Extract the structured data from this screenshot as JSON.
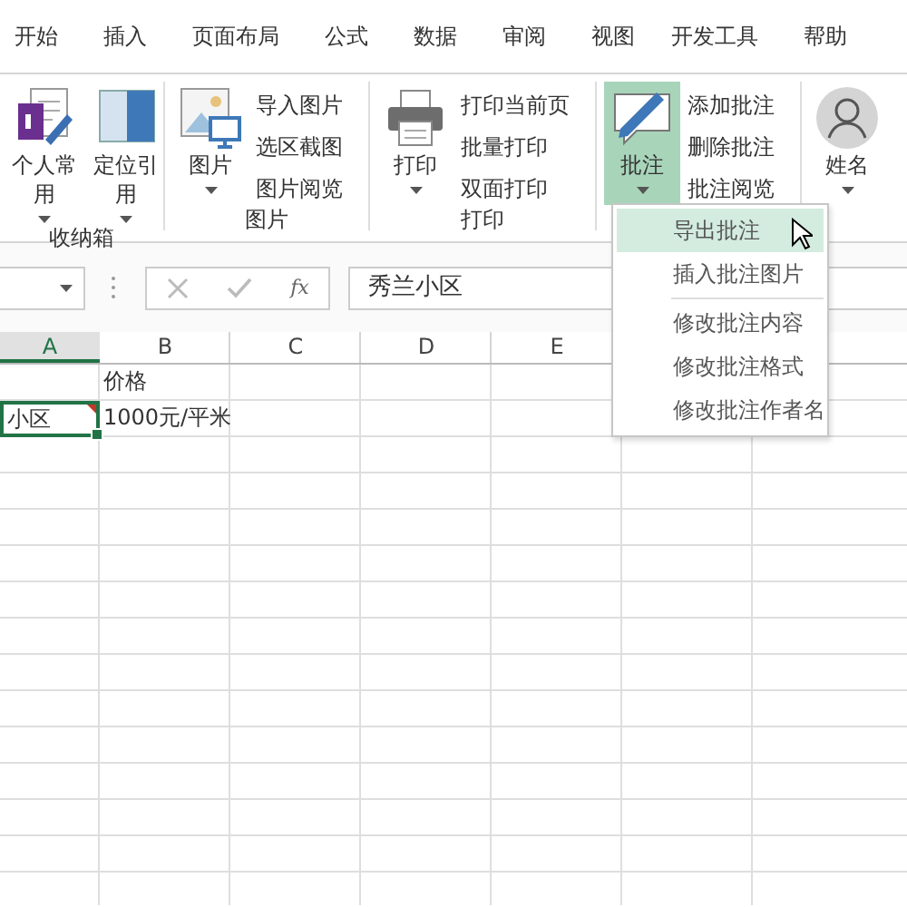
{
  "tabs": [
    {
      "label": "开始"
    },
    {
      "label": "插入"
    },
    {
      "label": "页面布局"
    },
    {
      "label": "公式"
    },
    {
      "label": "数据"
    },
    {
      "label": "审阅"
    },
    {
      "label": "视图"
    },
    {
      "label": "开发工具"
    },
    {
      "label": "帮助"
    }
  ],
  "ribbon": {
    "groups": [
      {
        "label": "收纳箱",
        "large": [
          {
            "label": "个人常用",
            "pressed": false
          },
          {
            "label": "定位引用",
            "pressed": false
          }
        ]
      },
      {
        "label": "图片",
        "large": [
          {
            "label": "图片",
            "pressed": false
          }
        ],
        "small": [
          "导入图片",
          "选区截图",
          "图片阅览"
        ]
      },
      {
        "label": "打印",
        "large": [
          {
            "label": "打印",
            "pressed": false
          }
        ],
        "small": [
          "打印当前页",
          "批量打印",
          "双面打印"
        ]
      },
      {
        "large": [
          {
            "label": "批注",
            "pressed": true
          }
        ],
        "small": [
          "添加批注",
          "删除批注",
          "批注阅览"
        ]
      },
      {
        "large": [
          {
            "label": "姓名",
            "pressed": false
          }
        ]
      }
    ]
  },
  "formula_bar": {
    "function_label": "fx",
    "value": "秀兰小区"
  },
  "sheet": {
    "columns": [
      {
        "label": "A",
        "selected": true
      },
      {
        "label": "B",
        "selected": false
      },
      {
        "label": "C",
        "selected": false
      },
      {
        "label": "D",
        "selected": false
      },
      {
        "label": "E",
        "selected": false
      }
    ],
    "rows": [
      {
        "cells": [
          {
            "selected": false,
            "comment": false
          },
          {
            "text": "价格",
            "selected": false,
            "comment": false
          }
        ]
      },
      {
        "cells": [
          {
            "text": "小区",
            "selected": true,
            "comment": true
          },
          {
            "text": "1000元/平米",
            "selected": false,
            "comment": false
          }
        ]
      }
    ]
  },
  "menu": {
    "items": [
      {
        "label": "导出批注",
        "highlighted": true,
        "separator_before": false
      },
      {
        "label": "插入批注图片",
        "highlighted": false,
        "separator_before": false
      },
      {
        "label": "修改批注内容",
        "highlighted": false,
        "separator_before": true
      },
      {
        "label": "修改批注格式",
        "highlighted": false,
        "separator_before": false
      },
      {
        "label": "修改批注作者名",
        "highlighted": false,
        "separator_before": false
      }
    ]
  }
}
